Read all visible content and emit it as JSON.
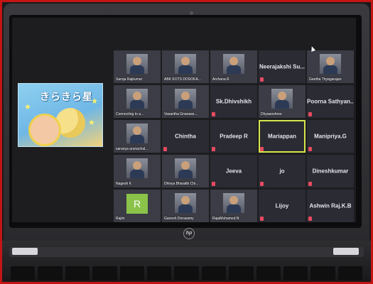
{
  "shared_image": {
    "title": "きらきら星"
  },
  "participants": [
    {
      "name": "Saroja Rajkumar",
      "kind": "video",
      "display": "label"
    },
    {
      "name": "ABK KOTS DOSOKA...",
      "kind": "video",
      "display": "label"
    },
    {
      "name": "Archana R",
      "kind": "video",
      "display": "label"
    },
    {
      "name": "Neerajakshi  Su...",
      "kind": "name",
      "display": "center"
    },
    {
      "name": "Geetha Thyagarajan",
      "kind": "video",
      "display": "label"
    },
    {
      "name": "Connecting to a...",
      "kind": "video",
      "display": "label"
    },
    {
      "name": "Vasantha Gnanase...",
      "kind": "video",
      "display": "label"
    },
    {
      "name": "Sk.Dhivshikh",
      "kind": "name",
      "display": "center"
    },
    {
      "name": "Dhyaanshree",
      "kind": "video",
      "display": "label"
    },
    {
      "name": "Poorna  Sathyan...",
      "kind": "name",
      "display": "center"
    },
    {
      "name": "saranya arunachal...",
      "kind": "video",
      "display": "label"
    },
    {
      "name": "Chintha",
      "kind": "name",
      "display": "center"
    },
    {
      "name": "Pradeep R",
      "kind": "name",
      "display": "center"
    },
    {
      "name": "Mariappan",
      "kind": "name",
      "display": "center",
      "active": true
    },
    {
      "name": "Manipriya.G",
      "kind": "name",
      "display": "center"
    },
    {
      "name": "Nagesh K",
      "kind": "video",
      "display": "label"
    },
    {
      "name": "Dhivya Bharathi Chi...",
      "kind": "video",
      "display": "label"
    },
    {
      "name": "Jeeva",
      "kind": "name",
      "display": "center"
    },
    {
      "name": "jo",
      "kind": "name",
      "display": "center"
    },
    {
      "name": "Dineshkumar",
      "kind": "name",
      "display": "center"
    },
    {
      "name": "Rajini",
      "kind": "avatar",
      "display": "label",
      "avatar_letter": "R"
    },
    {
      "name": "Ganesh Dorasamy",
      "kind": "video",
      "display": "label"
    },
    {
      "name": "RajaMohamed N",
      "kind": "video",
      "display": "label"
    },
    {
      "name": "Lijoy",
      "kind": "name",
      "display": "center"
    },
    {
      "name": "Ashwin Raj.K.B",
      "kind": "name",
      "display": "center"
    }
  ],
  "laptop": {
    "brand_logo": "hp"
  },
  "colors": {
    "frame": "#c41414",
    "active_outline": "#d6e64a",
    "avatar_bg": "#8bc34a",
    "mic_muted": "#e84a5f"
  }
}
